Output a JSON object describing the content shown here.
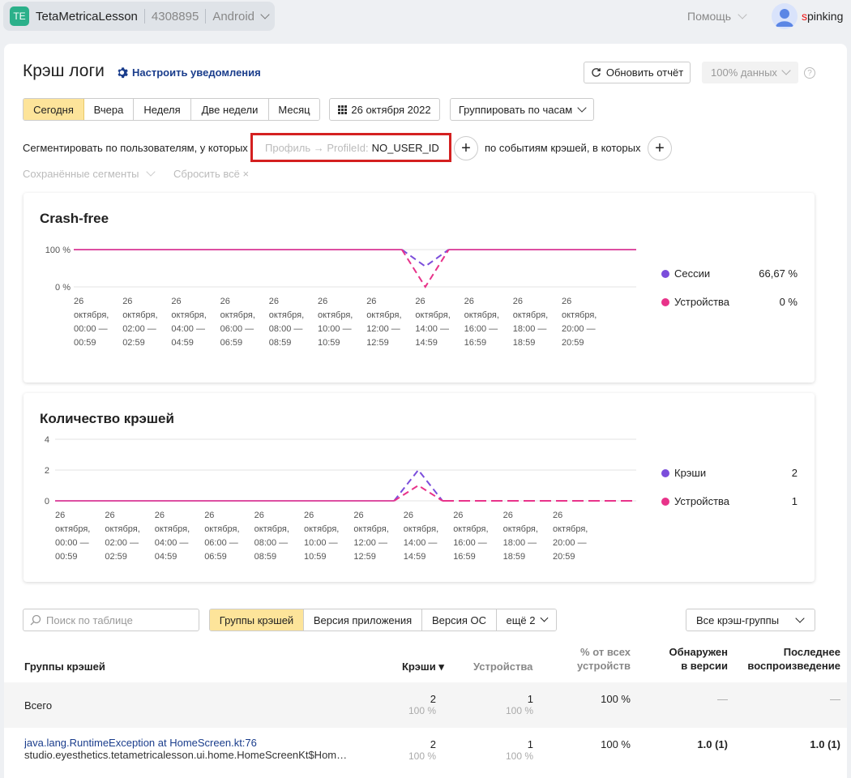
{
  "app": {
    "badge": "TE",
    "name": "TetaMetricaLesson",
    "id": "4308895",
    "platform": "Android"
  },
  "header": {
    "help_label": "Помощь",
    "user_first_letter": "s",
    "user_rest": "pinking"
  },
  "page": {
    "title": "Крэш логи",
    "notify_label": "Настроить уведомления",
    "refresh_label": "Обновить отчёт",
    "sample_label": "100% данных",
    "help_mark": "?"
  },
  "periods": {
    "today": "Сегодня",
    "yesterday": "Вчера",
    "week": "Неделя",
    "two_weeks": "Две недели",
    "month": "Месяц"
  },
  "date_label": "26 октября 2022",
  "group_label": "Группировать по часам",
  "segment": {
    "users_label": "Сегментировать по пользователям, у которых",
    "chip_key": "Профиль → ProfileId:",
    "chip_value": "NO_USER_ID",
    "events_label": "по событиям крэшей, в которых",
    "saved_label": "Сохранённые сегменты",
    "reset_label": "Сбросить всё ×"
  },
  "charts": {
    "crash_free": {
      "title": "Crash-free",
      "legend": [
        {
          "label": "Сессии",
          "value": "66,67 %",
          "color": "#7b4ddb"
        },
        {
          "label": "Устройства",
          "value": "0 %",
          "color": "#e8338a"
        }
      ]
    },
    "crash_count": {
      "title": "Количество крэшей",
      "legend": [
        {
          "label": "Крэши",
          "value": "2",
          "color": "#7b4ddb"
        },
        {
          "label": "Устройства",
          "value": "1",
          "color": "#e8338a"
        }
      ]
    }
  },
  "chart_data": [
    {
      "type": "line",
      "title": "Crash-free",
      "y_ticks": [
        "0 %",
        "100 %"
      ],
      "ylim": [
        0,
        100
      ],
      "x_labels": [
        [
          "26",
          "октября,",
          "00:00 —",
          "00:59"
        ],
        [
          "26",
          "октября,",
          "02:00 —",
          "02:59"
        ],
        [
          "26",
          "октября,",
          "04:00 —",
          "04:59"
        ],
        [
          "26",
          "октября,",
          "06:00 —",
          "06:59"
        ],
        [
          "26",
          "октября,",
          "08:00 —",
          "08:59"
        ],
        [
          "26",
          "октября,",
          "10:00 —",
          "10:59"
        ],
        [
          "26",
          "октября,",
          "12:00 —",
          "12:59"
        ],
        [
          "26",
          "октября,",
          "14:00 —",
          "14:59"
        ],
        [
          "26",
          "октября,",
          "16:00 —",
          "16:59"
        ],
        [
          "26",
          "октября,",
          "18:00 —",
          "18:59"
        ],
        [
          "26",
          "октября,",
          "20:00 —",
          "20:59"
        ]
      ],
      "x_hours": [
        0,
        1,
        2,
        3,
        4,
        5,
        6,
        7,
        8,
        9,
        10,
        11,
        12,
        13,
        14,
        15,
        16,
        17,
        18,
        19,
        20,
        21,
        22,
        23
      ],
      "series": [
        {
          "name": "Сессии",
          "color": "#7b4ddb",
          "values": [
            100,
            100,
            100,
            100,
            100,
            100,
            100,
            100,
            100,
            100,
            100,
            100,
            100,
            100,
            100,
            55,
            100,
            100,
            100,
            100,
            100,
            100,
            100,
            100,
            100
          ]
        },
        {
          "name": "Устройства",
          "color": "#e8338a",
          "values": [
            100,
            100,
            100,
            100,
            100,
            100,
            100,
            100,
            100,
            100,
            100,
            100,
            100,
            100,
            100,
            0,
            100,
            100,
            100,
            100,
            100,
            100,
            100,
            100,
            100
          ]
        }
      ]
    },
    {
      "type": "line",
      "title": "Количество крэшей",
      "y_ticks": [
        "0",
        "2",
        "4"
      ],
      "ylim": [
        0,
        4
      ],
      "x_labels": [
        [
          "26",
          "октября,",
          "00:00 —",
          "00:59"
        ],
        [
          "26",
          "октября,",
          "02:00 —",
          "02:59"
        ],
        [
          "26",
          "октября,",
          "04:00 —",
          "04:59"
        ],
        [
          "26",
          "октября,",
          "06:00 —",
          "06:59"
        ],
        [
          "26",
          "октября,",
          "08:00 —",
          "08:59"
        ],
        [
          "26",
          "октября,",
          "10:00 —",
          "10:59"
        ],
        [
          "26",
          "октября,",
          "12:00 —",
          "12:59"
        ],
        [
          "26",
          "октября,",
          "14:00 —",
          "14:59"
        ],
        [
          "26",
          "октября,",
          "16:00 —",
          "16:59"
        ],
        [
          "26",
          "октября,",
          "18:00 —",
          "18:59"
        ],
        [
          "26",
          "октября,",
          "20:00 —",
          "20:59"
        ]
      ],
      "series": [
        {
          "name": "Крэши",
          "color": "#7b4ddb",
          "values": [
            0,
            0,
            0,
            0,
            0,
            0,
            0,
            0,
            0,
            0,
            0,
            0,
            0,
            0,
            0,
            2,
            0,
            0,
            0,
            0,
            0,
            0,
            0,
            0,
            0
          ]
        },
        {
          "name": "Устройства",
          "color": "#e8338a",
          "values": [
            0,
            0,
            0,
            0,
            0,
            0,
            0,
            0,
            0,
            0,
            0,
            0,
            0,
            0,
            0,
            1,
            0,
            0,
            0,
            0,
            0,
            0,
            0,
            0,
            0
          ]
        }
      ]
    }
  ],
  "table_controls": {
    "search_placeholder": "Поиск по таблице",
    "tabs": [
      "Группы крэшей",
      "Версия приложения",
      "Версия ОС",
      "ещё 2"
    ],
    "filter_label": "Все крэш-группы"
  },
  "table": {
    "headers": {
      "group": "Группы крэшей",
      "crashes": "Крэши ▾",
      "devices": "Устройства",
      "pct_line1": "% от всех",
      "pct_line2": "устройств",
      "found_line1": "Обнаружен",
      "found_line2": "в версии",
      "last_line1": "Последнее",
      "last_line2": "воспроизведение"
    },
    "total": {
      "label": "Всего",
      "crashes": "2",
      "crashes_pct": "100 %",
      "devices": "1",
      "devices_pct": "100 %",
      "pct": "100 %",
      "found": "—",
      "last": "—"
    },
    "rows": [
      {
        "name": "java.lang.RuntimeException at HomeScreen.kt:76",
        "detail": "studio.eyesthetics.tetametricalesson.ui.home.HomeScreenKt$Hom…",
        "crashes": "2",
        "crashes_pct": "100 %",
        "devices": "1",
        "devices_pct": "100 %",
        "pct": "100 %",
        "found": "1.0 (1)",
        "last": "1.0 (1)"
      }
    ]
  }
}
